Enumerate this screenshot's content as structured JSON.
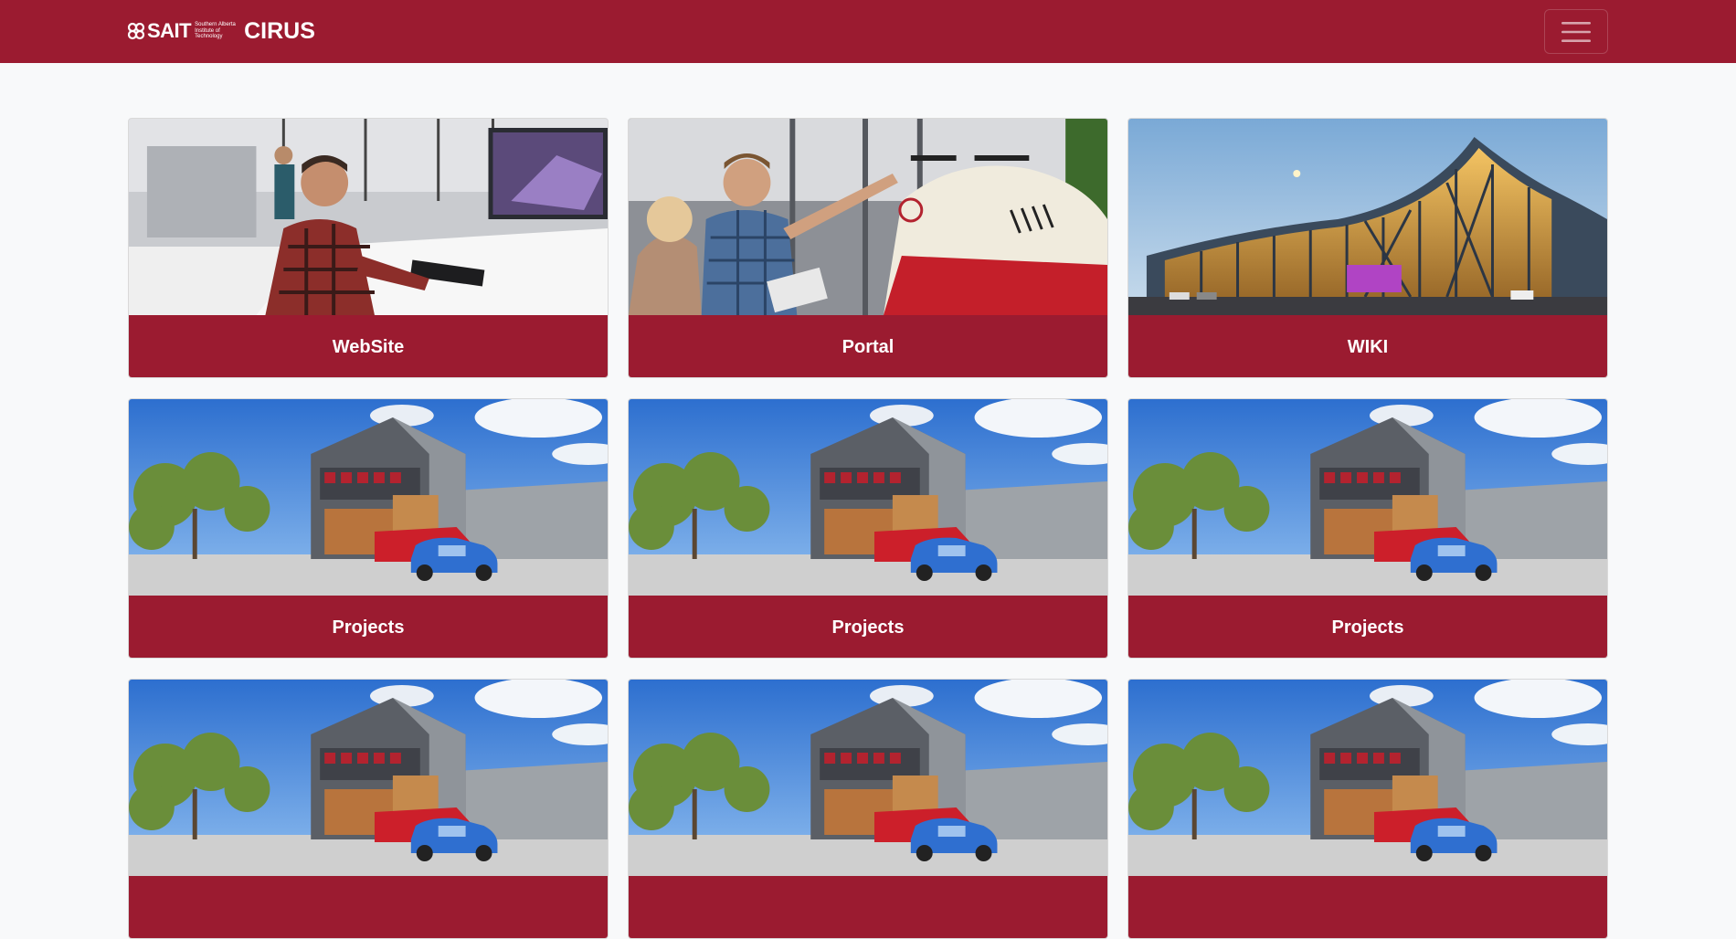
{
  "brand": {
    "logo_text": "SAIT",
    "logo_subtitle": "Southern Alberta Institute of Technology",
    "name": "CIRUS"
  },
  "navbar": {
    "toggler_icon": "hamburger-menu-icon",
    "brand_color": "#9b1b30"
  },
  "cards": [
    {
      "label": "WebSite",
      "image": "lab-workstation-photo"
    },
    {
      "label": "Portal",
      "image": "drone-lab-photo"
    },
    {
      "label": "WIKI",
      "image": "campus-building-photo"
    },
    {
      "label": "Projects",
      "image": "green-building-photo"
    },
    {
      "label": "Projects",
      "image": "green-building-photo"
    },
    {
      "label": "Projects",
      "image": "green-building-photo"
    },
    {
      "label": "",
      "image": "green-building-photo"
    },
    {
      "label": "",
      "image": "green-building-photo"
    },
    {
      "label": "",
      "image": "green-building-photo"
    }
  ]
}
